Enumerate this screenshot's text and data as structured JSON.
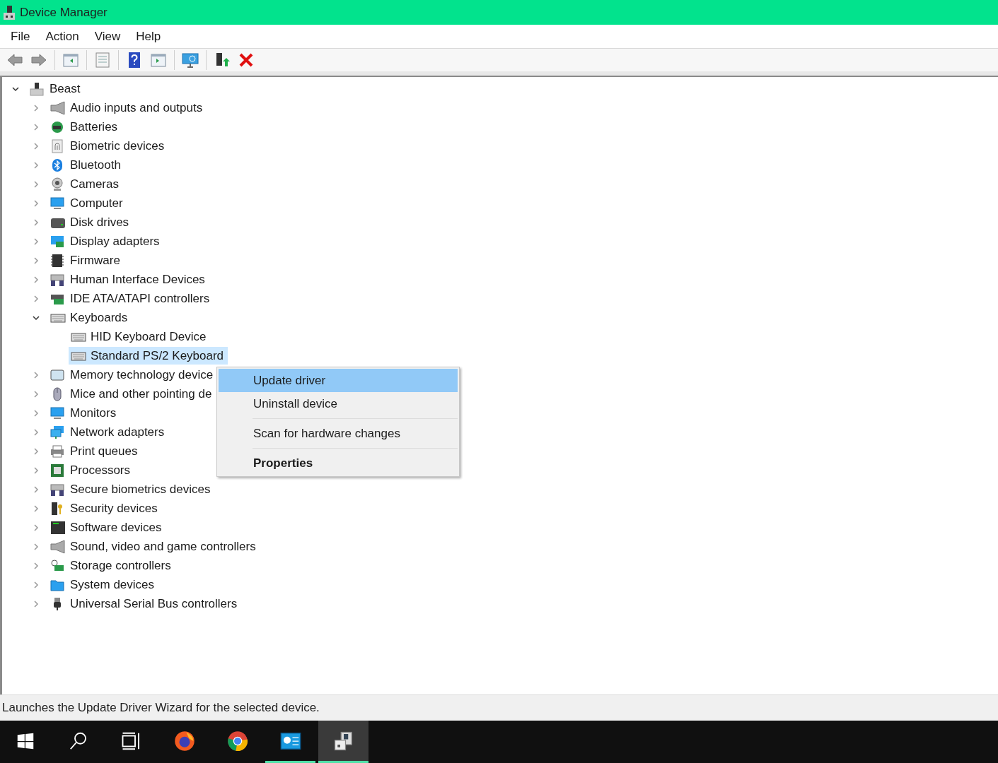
{
  "window": {
    "title": "Device Manager"
  },
  "menu_bar": [
    "File",
    "Action",
    "View",
    "Help"
  ],
  "toolbar": [
    {
      "kind": "back"
    },
    {
      "kind": "forward"
    },
    {
      "kind": "separator"
    },
    {
      "kind": "console-tree"
    },
    {
      "kind": "separator"
    },
    {
      "kind": "properties"
    },
    {
      "kind": "separator"
    },
    {
      "kind": "help"
    },
    {
      "kind": "action-pane"
    },
    {
      "kind": "separator"
    },
    {
      "kind": "scan"
    },
    {
      "kind": "separator"
    },
    {
      "kind": "update-driver"
    },
    {
      "kind": "uninstall"
    }
  ],
  "tree": [
    {
      "label": "Beast",
      "kind": "pc",
      "expanded": true,
      "selected": false,
      "children": [
        {
          "label": "Audio inputs and outputs",
          "kind": "speaker",
          "expanded": false,
          "selected": false
        },
        {
          "label": "Batteries",
          "kind": "battery",
          "expanded": false,
          "selected": false
        },
        {
          "label": "Biometric devices",
          "kind": "fingerprint",
          "expanded": false,
          "selected": false
        },
        {
          "label": "Bluetooth",
          "kind": "bluetooth",
          "expanded": false,
          "selected": false
        },
        {
          "label": "Cameras",
          "kind": "camera",
          "expanded": false,
          "selected": false
        },
        {
          "label": "Computer",
          "kind": "monitor",
          "expanded": false,
          "selected": false
        },
        {
          "label": "Disk drives",
          "kind": "disk",
          "expanded": false,
          "selected": false
        },
        {
          "label": "Display adapters",
          "kind": "display-card",
          "expanded": false,
          "selected": false
        },
        {
          "label": "Firmware",
          "kind": "chip",
          "expanded": false,
          "selected": false
        },
        {
          "label": "Human Interface Devices",
          "kind": "hid",
          "expanded": false,
          "selected": false
        },
        {
          "label": "IDE ATA/ATAPI controllers",
          "kind": "card",
          "expanded": false,
          "selected": false
        },
        {
          "label": "Keyboards",
          "kind": "keyboard",
          "expanded": true,
          "selected": false,
          "children": [
            {
              "label": "HID Keyboard Device",
              "kind": "keyboard",
              "selected": false
            },
            {
              "label": "Standard PS/2 Keyboard",
              "kind": "keyboard",
              "selected": true
            }
          ]
        },
        {
          "label": "Memory technology device",
          "kind": "memory",
          "expanded": false,
          "selected": false
        },
        {
          "label": "Mice and other pointing de",
          "kind": "mouse",
          "expanded": false,
          "selected": false
        },
        {
          "label": "Monitors",
          "kind": "monitor",
          "expanded": false,
          "selected": false
        },
        {
          "label": "Network adapters",
          "kind": "network",
          "expanded": false,
          "selected": false
        },
        {
          "label": "Print queues",
          "kind": "printer",
          "expanded": false,
          "selected": false
        },
        {
          "label": "Processors",
          "kind": "processor",
          "expanded": false,
          "selected": false
        },
        {
          "label": "Secure biometrics devices",
          "kind": "hid",
          "expanded": false,
          "selected": false
        },
        {
          "label": "Security devices",
          "kind": "security",
          "expanded": false,
          "selected": false
        },
        {
          "label": "Software devices",
          "kind": "tower",
          "expanded": false,
          "selected": false
        },
        {
          "label": "Sound, video and game controllers",
          "kind": "speaker",
          "expanded": false,
          "selected": false
        },
        {
          "label": "Storage controllers",
          "kind": "storage",
          "expanded": false,
          "selected": false
        },
        {
          "label": "System devices",
          "kind": "folder",
          "expanded": false,
          "selected": false
        },
        {
          "label": "Universal Serial Bus controllers",
          "kind": "usb",
          "expanded": false,
          "selected": false
        }
      ]
    }
  ],
  "context_menu": [
    {
      "kind": "item",
      "label": "Update driver",
      "selected": true,
      "default": false
    },
    {
      "kind": "item",
      "label": "Uninstall device",
      "selected": false,
      "default": false
    },
    {
      "kind": "separator"
    },
    {
      "kind": "item",
      "label": "Scan for hardware changes",
      "selected": false,
      "default": false
    },
    {
      "kind": "separator"
    },
    {
      "kind": "item",
      "label": "Properties",
      "selected": false,
      "default": true
    }
  ],
  "status_bar": "Launches the Update Driver Wizard for the selected device.",
  "taskbar": [
    {
      "kind": "start",
      "running": false,
      "active": false
    },
    {
      "kind": "search",
      "running": false,
      "active": false
    },
    {
      "kind": "task-view",
      "running": false,
      "active": false
    },
    {
      "kind": "firefox",
      "running": false,
      "active": false
    },
    {
      "kind": "chrome",
      "running": false,
      "active": false
    },
    {
      "kind": "control-panel",
      "running": true,
      "active": false
    },
    {
      "kind": "device-manager",
      "running": true,
      "active": true
    }
  ]
}
